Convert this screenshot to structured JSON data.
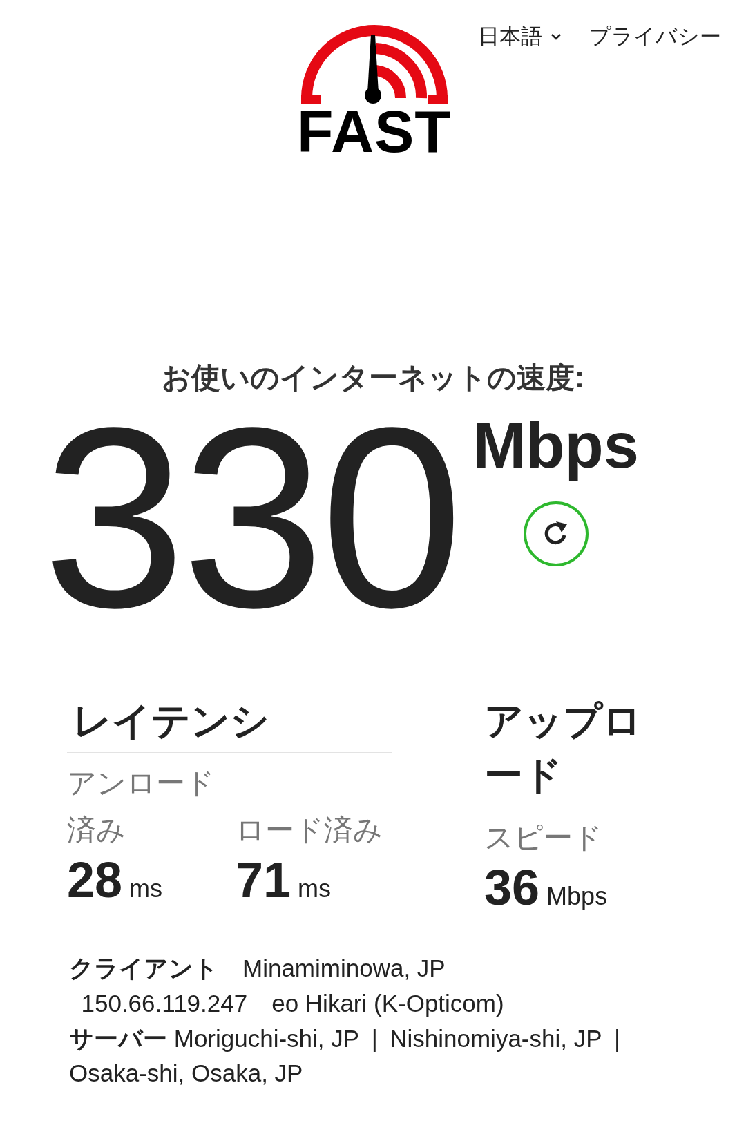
{
  "header": {
    "language": {
      "label": "日本語"
    },
    "privacy_link": "プライバシー"
  },
  "logo": {
    "text": "FAST"
  },
  "speed": {
    "title": "お使いのインターネットの速度:",
    "value": "330",
    "unit": "Mbps"
  },
  "latency": {
    "title": "レイテンシ",
    "metrics": [
      {
        "label": "アンロード済み",
        "value": "28",
        "unit": "ms"
      },
      {
        "label": "ロード済み",
        "value": "71",
        "unit": "ms"
      }
    ]
  },
  "upload": {
    "title": "アップロード",
    "metrics": [
      {
        "label": "スピード",
        "value": "36",
        "unit": "Mbps"
      }
    ]
  },
  "info": {
    "client": {
      "label": "クライアント",
      "location": "Minamiminowa, JP",
      "ip": "150.66.119.247",
      "isp": "eo Hikari (K-Opticom)"
    },
    "server": {
      "label": "サーバー",
      "separator": "|",
      "locations": [
        "Moriguchi-shi, JP",
        "Nishinomiya-shi, JP",
        "Osaka-shi, Osaka, JP"
      ]
    }
  }
}
